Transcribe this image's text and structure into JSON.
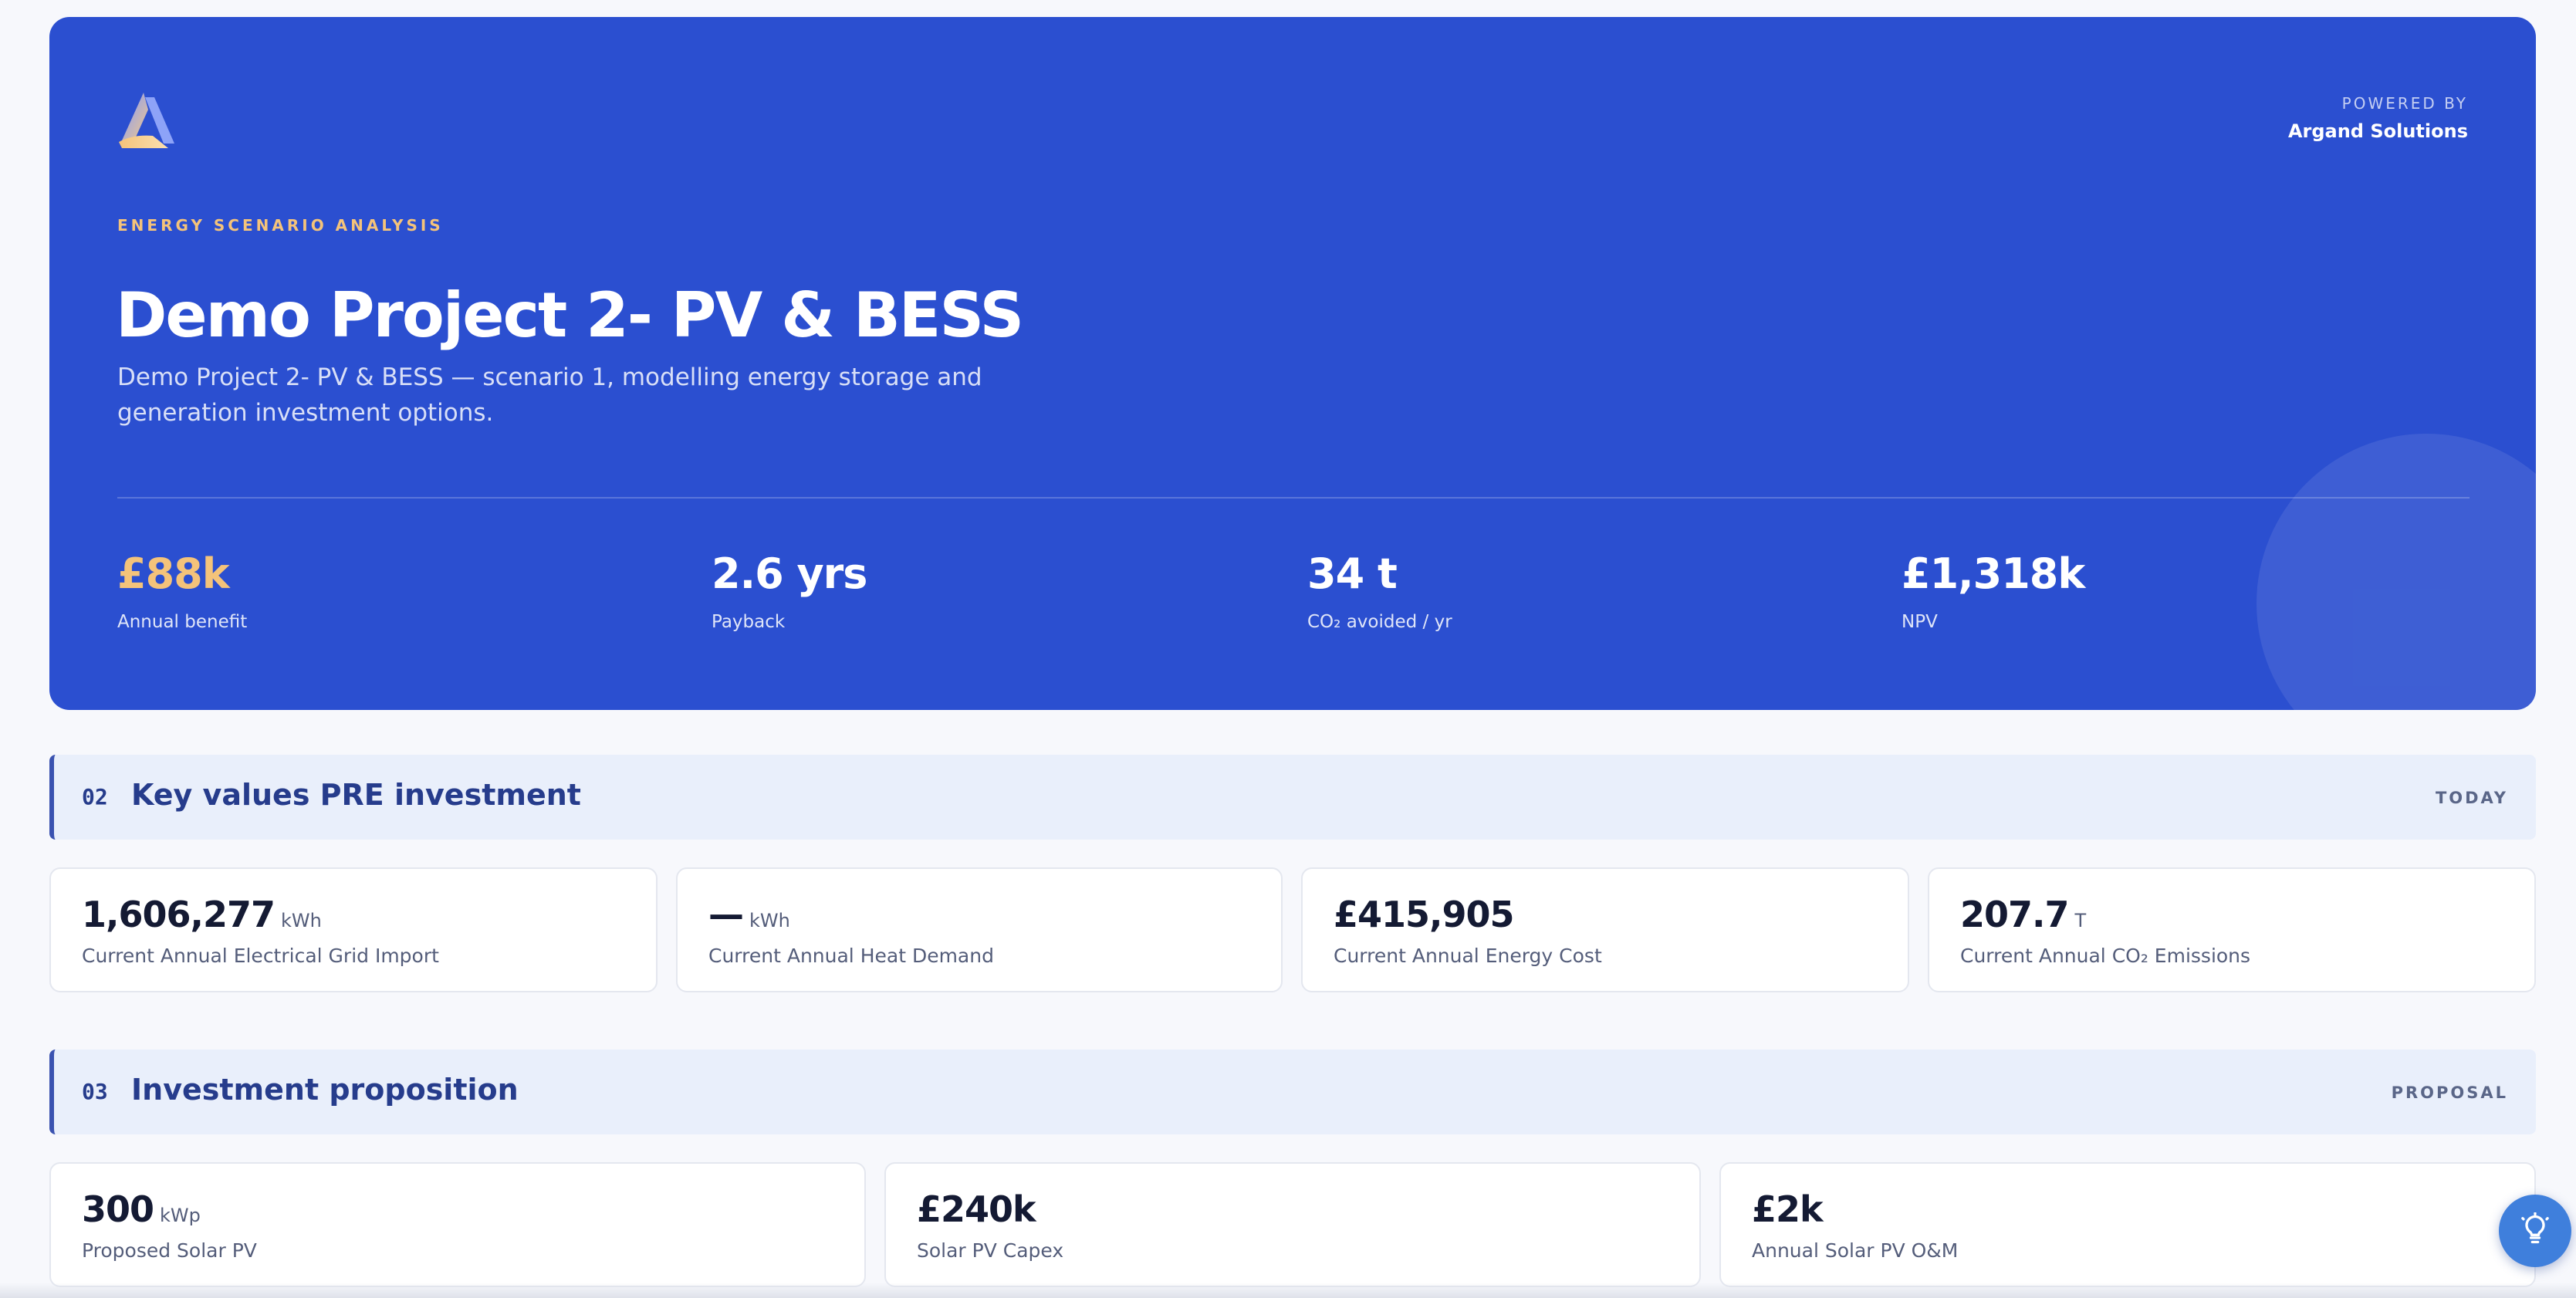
{
  "hero": {
    "powered_by_label": "POWERED BY",
    "powered_by_name": "Argand Solutions",
    "eyebrow": "ENERGY SCENARIO ANALYSIS",
    "title": "Demo Project 2- PV & BESS",
    "subtitle": "Demo Project 2- PV & BESS — scenario 1, modelling energy storage and generation investment options.",
    "stats": [
      {
        "value": "£88k",
        "label": "Annual benefit"
      },
      {
        "value": "2.6 yrs",
        "label": "Payback"
      },
      {
        "value": "34 t",
        "label": "CO₂ avoided / yr"
      },
      {
        "value": "£1,318k",
        "label": "NPV"
      }
    ]
  },
  "sections": [
    {
      "number": "02",
      "title": "Key values PRE investment",
      "tag": "TODAY",
      "cards": [
        {
          "value": "1,606,277",
          "unit": "kWh",
          "label": "Current Annual Electrical Grid Import"
        },
        {
          "value": "—",
          "unit": "kWh",
          "label": "Current Annual Heat Demand"
        },
        {
          "value": "£415,905",
          "unit": "",
          "label": "Current Annual Energy Cost"
        },
        {
          "value": "207.7",
          "unit": "T",
          "label": "Current Annual CO₂ Emissions"
        }
      ]
    },
    {
      "number": "03",
      "title": "Investment proposition",
      "tag": "PROPOSAL",
      "cards": [
        {
          "value": "300",
          "unit": "kWp",
          "label": "Proposed Solar PV"
        },
        {
          "value": "£240k",
          "unit": "",
          "label": "Solar PV Capex"
        },
        {
          "value": "£2k",
          "unit": "",
          "label": "Annual Solar PV O&M"
        }
      ]
    }
  ],
  "icons": {
    "logo": "argand-logo-icon",
    "fab": "lightbulb-icon"
  },
  "colors": {
    "hero_bg": "#2b4fd0",
    "accent": "#f4c37a",
    "section_bg": "#e9effb",
    "section_text": "#263c8c",
    "fab_bg": "#3f7fdc"
  }
}
